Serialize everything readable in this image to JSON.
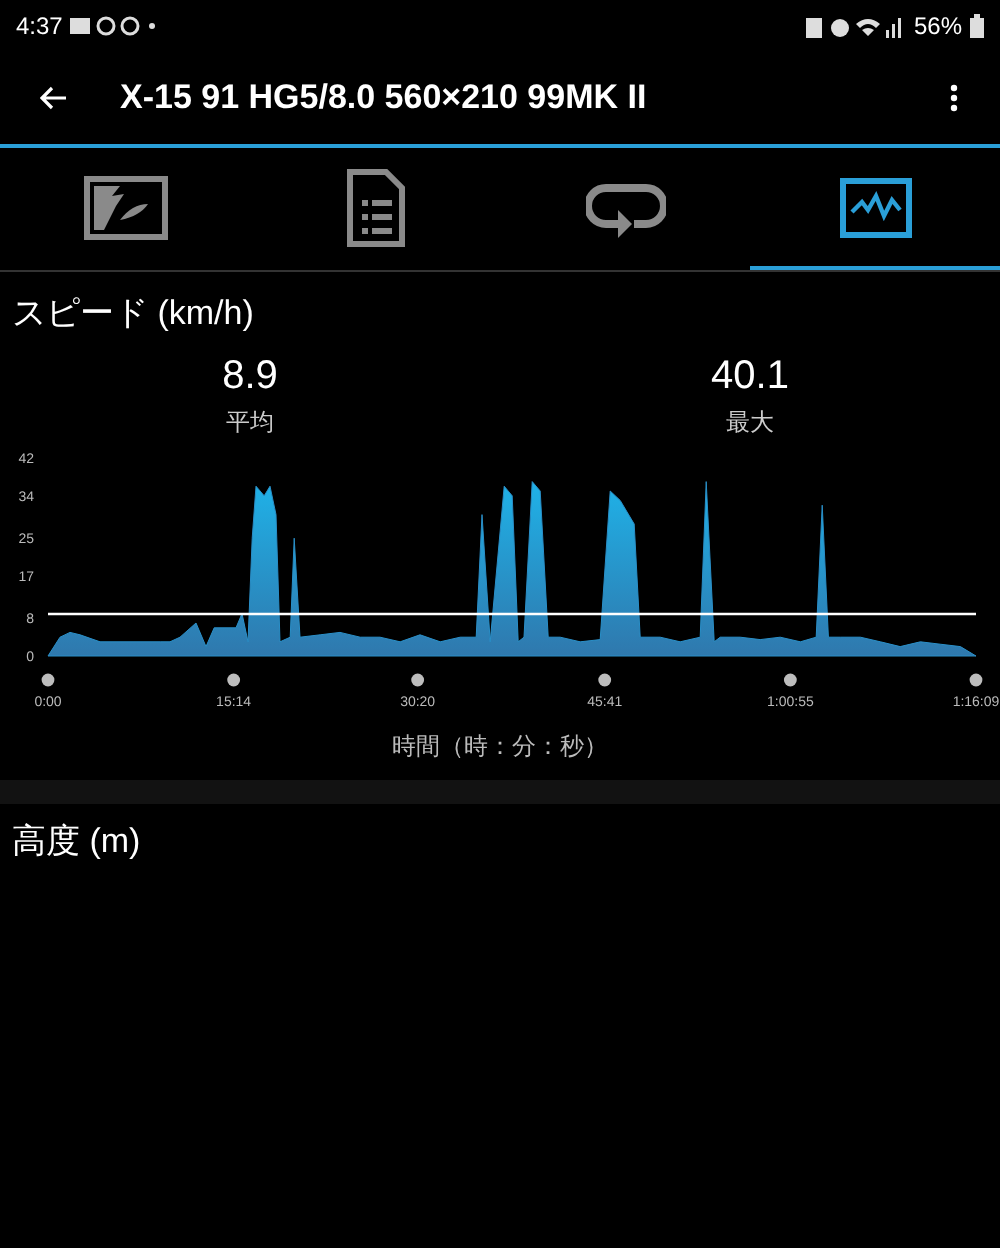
{
  "status_bar": {
    "time": "4:37",
    "battery": "56%"
  },
  "app_bar": {
    "title": "X-15 91 HG5/8.0 560×210 99MK II"
  },
  "tabs": [
    {
      "kind": "map",
      "selected": false
    },
    {
      "kind": "document",
      "selected": false
    },
    {
      "kind": "loop",
      "selected": false
    },
    {
      "kind": "chart",
      "selected": true
    }
  ],
  "speed": {
    "title": "スピード (km/h)",
    "stats": [
      {
        "value": "8.9",
        "label": "平均"
      },
      {
        "value": "40.1",
        "label": "最大"
      }
    ],
    "chart_data": {
      "type": "area",
      "xlabel": "時間（時：分：秒）",
      "x": [
        0,
        59,
        108,
        158,
        256,
        552,
        601,
        650,
        729,
        778,
        818,
        926,
        955,
        985,
        1005,
        1024,
        1064,
        1093,
        1123,
        1142,
        1192,
        1212,
        1241,
        1340,
        1438,
        1537,
        1635,
        1734,
        1832,
        1931,
        2029,
        2108,
        2137,
        2177,
        2246,
        2285,
        2315,
        2344,
        2384,
        2423,
        2463,
        2522,
        2620,
        2719,
        2768,
        2817,
        2886,
        2916,
        3014,
        3113,
        3211,
        3241,
        3280,
        3310,
        3408,
        3507,
        3605,
        3704,
        3782,
        3812,
        3842,
        3901,
        4000,
        4098,
        4196,
        4295,
        4393,
        4492,
        4569
      ],
      "series": [
        {
          "color": "#2a8fc8",
          "values": [
            0,
            4,
            5,
            4.5,
            3,
            3,
            3,
            4,
            7,
            2,
            6,
            6,
            9,
            3,
            25,
            36,
            34,
            36,
            30,
            3,
            4,
            25,
            4,
            4.5,
            5,
            4,
            4,
            3,
            4.5,
            3,
            4,
            4,
            30,
            3,
            36,
            34,
            3,
            4,
            37,
            35,
            4,
            4,
            3,
            3.5,
            35,
            33,
            28,
            4,
            4,
            3,
            4,
            37,
            3,
            4,
            4,
            3.5,
            4,
            3,
            4,
            32,
            4,
            4,
            4,
            3,
            2,
            3,
            2.5,
            2,
            0
          ]
        }
      ],
      "xlim": [
        0,
        4569
      ],
      "ylim": [
        0,
        42
      ],
      "xticks": [
        {
          "value": 0,
          "label": "0:00"
        },
        {
          "value": 914,
          "label": "15:14"
        },
        {
          "value": 1820,
          "label": "30:20"
        },
        {
          "value": 2741,
          "label": "45:41"
        },
        {
          "value": 3655,
          "label": "1:00:55"
        },
        {
          "value": 4569,
          "label": "1:16:09"
        }
      ],
      "yticks": [
        0,
        8,
        17,
        25,
        34,
        42
      ],
      "ref_lines": [
        {
          "axis": "y",
          "value": 8.9
        }
      ]
    }
  },
  "altitude": {
    "title": "高度 (m)"
  }
}
